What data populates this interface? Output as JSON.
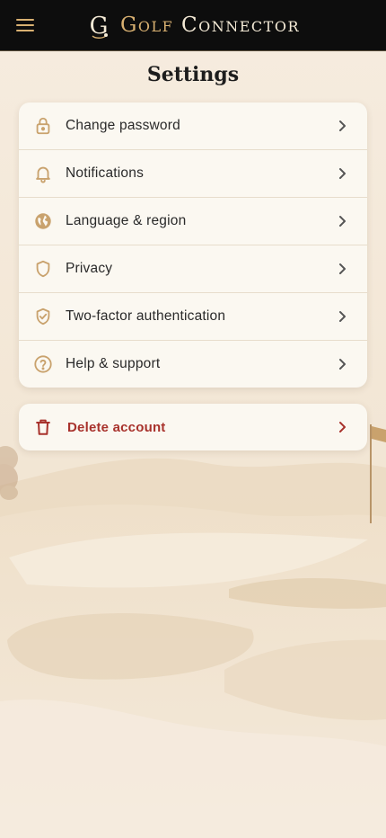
{
  "header": {
    "title_word1": "Golf",
    "title_word2": "Connector",
    "logo_letter": "G",
    "menu_icon": "hamburger-menu-icon"
  },
  "page": {
    "title": "Settings"
  },
  "settings": {
    "items": [
      {
        "label": "Change password",
        "icon": "lock-icon"
      },
      {
        "label": "Notifications",
        "icon": "bell-icon"
      },
      {
        "label": "Language & region",
        "icon": "globe-icon"
      },
      {
        "label": "Privacy",
        "icon": "shield-icon"
      },
      {
        "label": "Two-factor authentication",
        "icon": "shield-check-icon"
      },
      {
        "label": "Help & support",
        "icon": "help-circle-icon"
      }
    ]
  },
  "danger": {
    "label": "Delete account",
    "icon": "trash-icon"
  },
  "colors": {
    "header_bg": "#0d0d0d",
    "gold_accent": "#d8b071",
    "card_bg": "#fbf8f1",
    "danger_red": "#a8322c",
    "page_bg": "#f3e6d4"
  }
}
